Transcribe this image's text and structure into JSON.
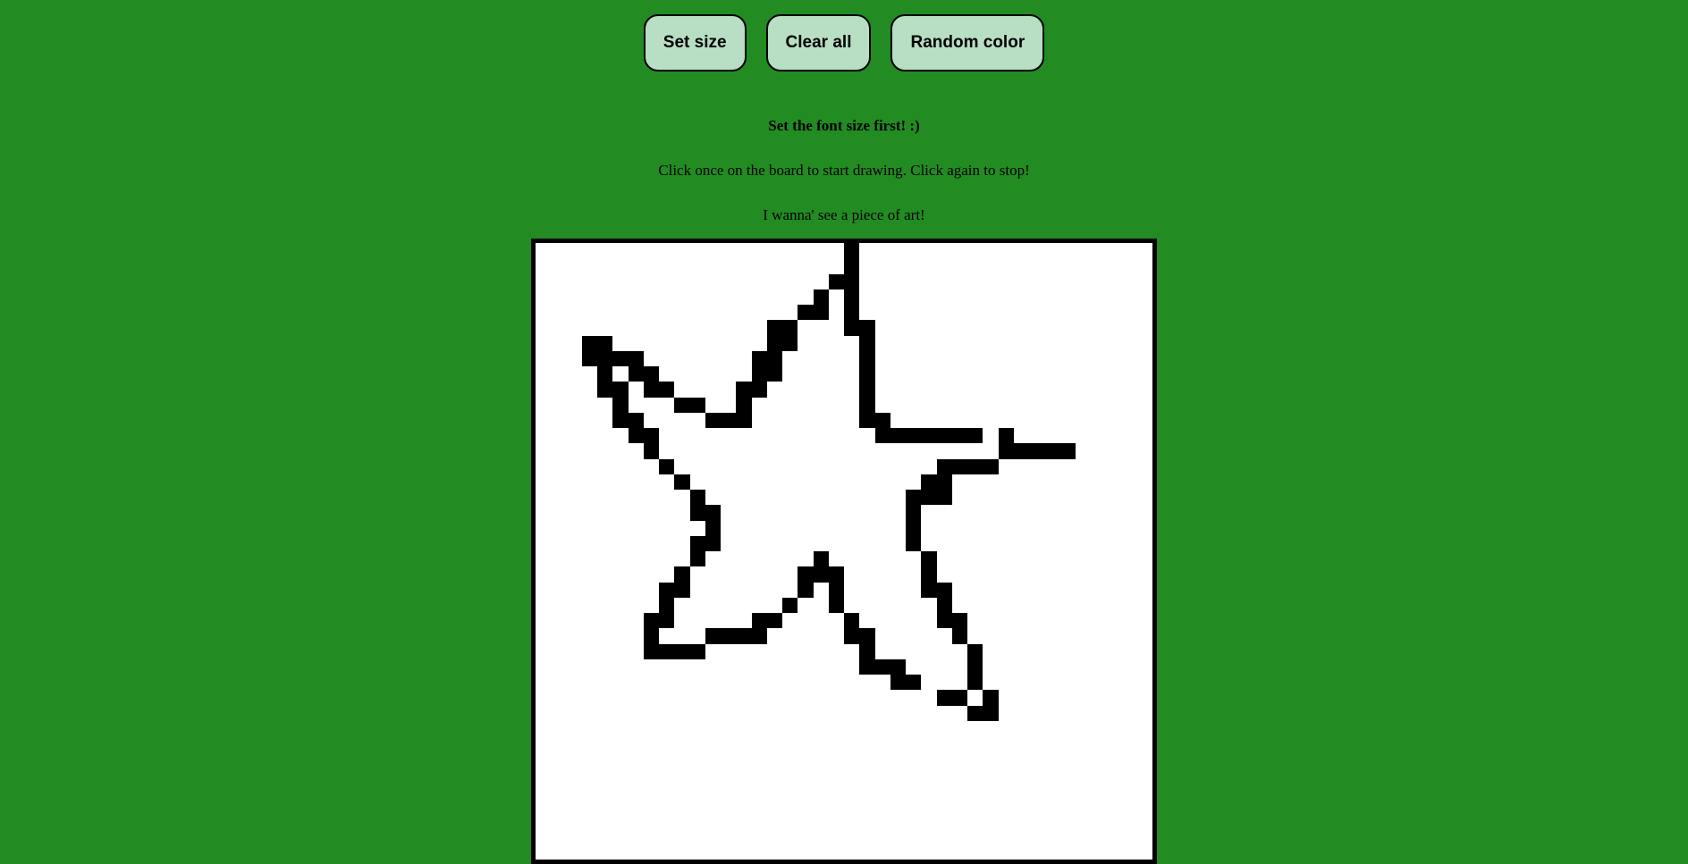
{
  "toolbar": {
    "set_size_label": "Set size",
    "clear_all_label": "Clear all",
    "random_color_label": "Random color"
  },
  "messages": {
    "font_size_hint": "Set the font size first! :)",
    "instructions": "Click once on the board to start drawing. Click again to stop!",
    "encouragement": "I wanna' see a piece of art!"
  },
  "board": {
    "grid_size": 40,
    "ink_color": "#000000",
    "background_color": "#ffffff",
    "filled_cells": [
      [
        0,
        20
      ],
      [
        1,
        20
      ],
      [
        2,
        19
      ],
      [
        2,
        20
      ],
      [
        3,
        18
      ],
      [
        3,
        20
      ],
      [
        4,
        17
      ],
      [
        4,
        18
      ],
      [
        4,
        20
      ],
      [
        5,
        15
      ],
      [
        5,
        16
      ],
      [
        5,
        20
      ],
      [
        5,
        21
      ],
      [
        6,
        3
      ],
      [
        6,
        4
      ],
      [
        6,
        15
      ],
      [
        6,
        16
      ],
      [
        6,
        21
      ],
      [
        7,
        3
      ],
      [
        7,
        4
      ],
      [
        7,
        5
      ],
      [
        7,
        6
      ],
      [
        7,
        14
      ],
      [
        7,
        15
      ],
      [
        7,
        21
      ],
      [
        8,
        4
      ],
      [
        8,
        6
      ],
      [
        8,
        7
      ],
      [
        8,
        14
      ],
      [
        8,
        15
      ],
      [
        8,
        21
      ],
      [
        9,
        4
      ],
      [
        9,
        5
      ],
      [
        9,
        7
      ],
      [
        9,
        8
      ],
      [
        9,
        13
      ],
      [
        9,
        14
      ],
      [
        9,
        21
      ],
      [
        10,
        5
      ],
      [
        10,
        9
      ],
      [
        10,
        10
      ],
      [
        10,
        13
      ],
      [
        10,
        21
      ],
      [
        11,
        5
      ],
      [
        11,
        6
      ],
      [
        11,
        11
      ],
      [
        11,
        12
      ],
      [
        11,
        13
      ],
      [
        11,
        21
      ],
      [
        11,
        22
      ],
      [
        12,
        6
      ],
      [
        12,
        7
      ],
      [
        12,
        22
      ],
      [
        12,
        23
      ],
      [
        12,
        24
      ],
      [
        12,
        25
      ],
      [
        12,
        26
      ],
      [
        12,
        27
      ],
      [
        12,
        28
      ],
      [
        12,
        30
      ],
      [
        13,
        7
      ],
      [
        13,
        30
      ],
      [
        13,
        31
      ],
      [
        13,
        32
      ],
      [
        13,
        33
      ],
      [
        13,
        34
      ],
      [
        14,
        8
      ],
      [
        14,
        26
      ],
      [
        14,
        27
      ],
      [
        14,
        28
      ],
      [
        14,
        29
      ],
      [
        15,
        9
      ],
      [
        15,
        25
      ],
      [
        15,
        26
      ],
      [
        16,
        10
      ],
      [
        16,
        24
      ],
      [
        16,
        25
      ],
      [
        16,
        26
      ],
      [
        17,
        10
      ],
      [
        17,
        11
      ],
      [
        17,
        24
      ],
      [
        18,
        11
      ],
      [
        18,
        24
      ],
      [
        19,
        10
      ],
      [
        19,
        11
      ],
      [
        19,
        24
      ],
      [
        20,
        10
      ],
      [
        20,
        18
      ],
      [
        20,
        25
      ],
      [
        21,
        9
      ],
      [
        21,
        17
      ],
      [
        21,
        18
      ],
      [
        21,
        19
      ],
      [
        21,
        25
      ],
      [
        22,
        8
      ],
      [
        22,
        9
      ],
      [
        22,
        17
      ],
      [
        22,
        19
      ],
      [
        22,
        25
      ],
      [
        22,
        26
      ],
      [
        23,
        8
      ],
      [
        23,
        16
      ],
      [
        23,
        19
      ],
      [
        23,
        26
      ],
      [
        24,
        7
      ],
      [
        24,
        8
      ],
      [
        24,
        14
      ],
      [
        24,
        15
      ],
      [
        24,
        20
      ],
      [
        24,
        26
      ],
      [
        24,
        27
      ],
      [
        25,
        7
      ],
      [
        25,
        11
      ],
      [
        25,
        12
      ],
      [
        25,
        13
      ],
      [
        25,
        14
      ],
      [
        25,
        20
      ],
      [
        25,
        21
      ],
      [
        25,
        27
      ],
      [
        26,
        7
      ],
      [
        26,
        8
      ],
      [
        26,
        9
      ],
      [
        26,
        10
      ],
      [
        26,
        21
      ],
      [
        26,
        28
      ],
      [
        27,
        21
      ],
      [
        27,
        22
      ],
      [
        27,
        23
      ],
      [
        27,
        28
      ],
      [
        28,
        23
      ],
      [
        28,
        24
      ],
      [
        28,
        28
      ],
      [
        29,
        26
      ],
      [
        29,
        27
      ],
      [
        29,
        29
      ],
      [
        30,
        28
      ],
      [
        30,
        29
      ]
    ]
  }
}
